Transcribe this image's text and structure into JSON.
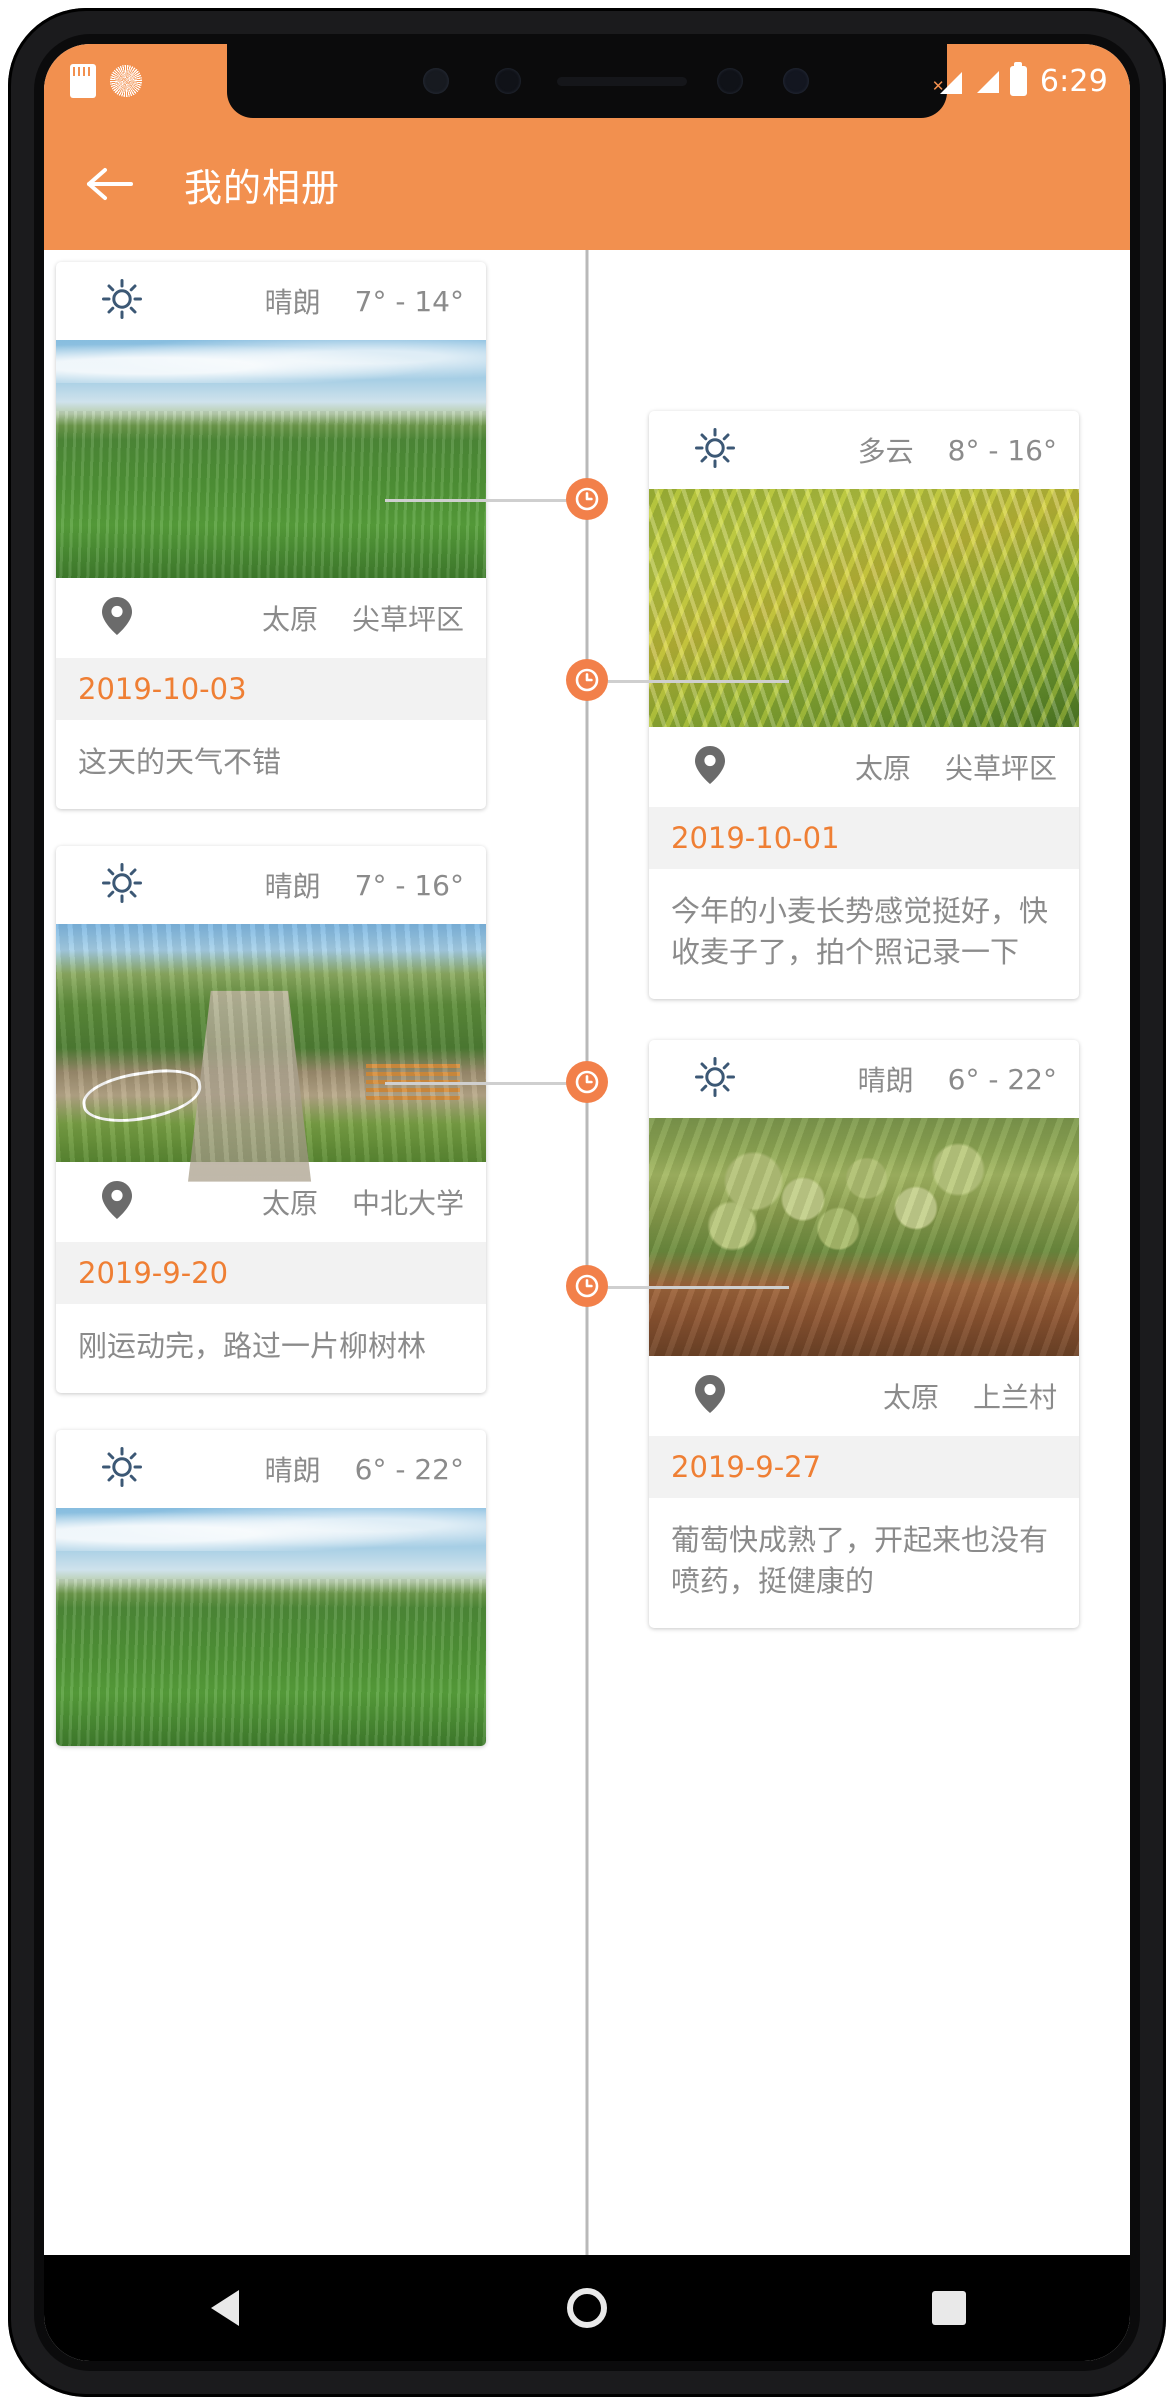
{
  "status_bar": {
    "time": "6:29",
    "left_icons": [
      "sim-card-icon",
      "sync-icon"
    ],
    "right_icons": [
      "signal-no-service-icon",
      "signal-icon",
      "battery-icon"
    ]
  },
  "app_bar": {
    "back_icon": "arrow-left-icon",
    "title": "我的相册",
    "background_color": "#f2904f",
    "title_color": "#ffffff"
  },
  "theme": {
    "accent": "#f2904f",
    "date_text": "#ef7f34",
    "body_text": "#8b8b8b",
    "timeline_line": "#b9b9b9",
    "date_band_bg": "#f2f2f2"
  },
  "timeline": {
    "dot_icon": "clock-icon",
    "entries": [
      {
        "side": "left",
        "weather_icon": "sun-icon",
        "weather": "晴朗",
        "temperature": "7° - 14°",
        "photo": "wheat-field-photo",
        "location_icon": "location-pin-icon",
        "city": "太原",
        "area": "尖草坪区",
        "date": "2019-10-03",
        "note": "这天的天气不错"
      },
      {
        "side": "right",
        "weather_icon": "sun-icon",
        "weather": "多云",
        "temperature": "8° - 16°",
        "photo": "rice-crop-photo",
        "location_icon": "location-pin-icon",
        "city": "太原",
        "area": "尖草坪区",
        "date": "2019-10-01",
        "note": "今年的小麦长势感觉挺好，快收麦子了，拍个照记录一下"
      },
      {
        "side": "left",
        "weather_icon": "sun-icon",
        "weather": "晴朗",
        "temperature": "7° - 16°",
        "photo": "park-path-photo",
        "location_icon": "location-pin-icon",
        "city": "太原",
        "area": "中北大学",
        "date": "2019-9-20",
        "note": "刚运动完，路过一片柳树林"
      },
      {
        "side": "right",
        "weather_icon": "sun-icon",
        "weather": "晴朗",
        "temperature": "6° - 22°",
        "photo": "grape-vine-photo",
        "location_icon": "location-pin-icon",
        "city": "太原",
        "area": "上兰村",
        "date": "2019-9-27",
        "note": "葡萄快成熟了，开起来也没有喷药，挺健康的"
      },
      {
        "side": "left",
        "weather_icon": "sun-icon",
        "weather": "晴朗",
        "temperature": "6° - 22°",
        "photo": "partial-photo",
        "location_icon": "location-pin-icon",
        "city": "",
        "area": "",
        "date": "",
        "note": ""
      }
    ]
  },
  "nav_bar": {
    "buttons": [
      "back-triangle-icon",
      "home-circle-icon",
      "recents-square-icon"
    ]
  }
}
